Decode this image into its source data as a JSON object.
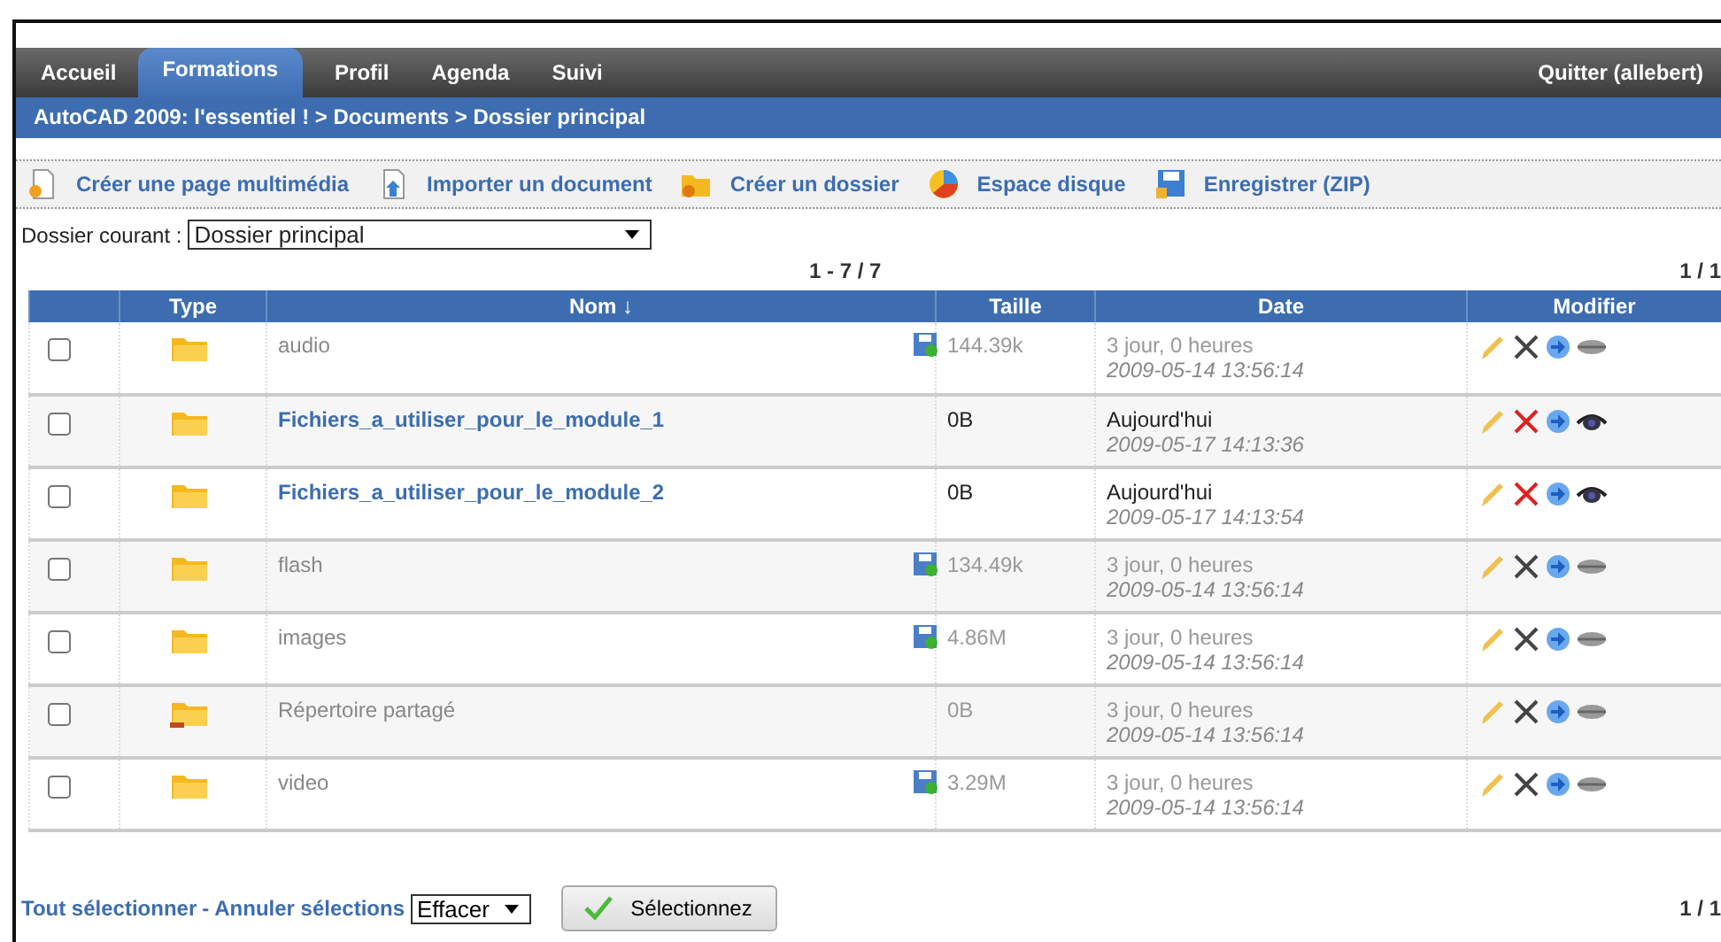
{
  "nav": {
    "tabs": [
      {
        "label": "Accueil",
        "selected": false
      },
      {
        "label": "Formations",
        "selected": true
      },
      {
        "label": "Profil",
        "selected": false
      },
      {
        "label": "Agenda",
        "selected": false
      },
      {
        "label": "Suivi",
        "selected": false
      }
    ],
    "logout": "Quitter (allebert)"
  },
  "breadcrumb": "AutoCAD 2009: l'essentiel ! > Documents > Dossier principal",
  "toolbar": [
    {
      "kind": "new-page",
      "label": "Créer une page multimédia"
    },
    {
      "kind": "upload",
      "label": "Importer un document"
    },
    {
      "kind": "new-folder",
      "label": "Créer un dossier"
    },
    {
      "kind": "disk",
      "label": "Espace disque"
    },
    {
      "kind": "save",
      "label": "Enregistrer (ZIP)"
    }
  ],
  "current_folder": {
    "label": "Dossier courant :",
    "value": "Dossier principal"
  },
  "pagination": {
    "range": "1 - 7 / 7",
    "pages": "1 / 1"
  },
  "table": {
    "columns": [
      "Type",
      "Nom ↓",
      "Taille",
      "Date",
      "Modifier"
    ],
    "rows": [
      {
        "checked": false,
        "kind": "folder",
        "name": "audio",
        "visible": false,
        "zip": true,
        "size": "144.39k",
        "age": "3 jour, 0 heures",
        "date": "2009-05-14 13:56:14"
      },
      {
        "checked": false,
        "kind": "folder",
        "name": "Fichiers_a_utiliser_pour_le_module_1",
        "visible": true,
        "zip": false,
        "size": "0B",
        "age": "Aujourd'hui",
        "date": "2009-05-17 14:13:36"
      },
      {
        "checked": false,
        "kind": "folder",
        "name": "Fichiers_a_utiliser_pour_le_module_2",
        "visible": true,
        "zip": false,
        "size": "0B",
        "age": "Aujourd'hui",
        "date": "2009-05-17 14:13:54"
      },
      {
        "checked": false,
        "kind": "folder",
        "name": "flash",
        "visible": false,
        "zip": true,
        "size": "134.49k",
        "age": "3 jour, 0 heures",
        "date": "2009-05-14 13:56:14"
      },
      {
        "checked": false,
        "kind": "folder",
        "name": "images",
        "visible": false,
        "zip": true,
        "size": "4.86M",
        "age": "3 jour, 0 heures",
        "date": "2009-05-14 13:56:14"
      },
      {
        "checked": false,
        "kind": "shared",
        "name": "Répertoire partagé",
        "visible": false,
        "zip": false,
        "size": "0B",
        "age": "3 jour, 0 heures",
        "date": "2009-05-14 13:56:14"
      },
      {
        "checked": false,
        "kind": "folder",
        "name": "video",
        "visible": false,
        "zip": true,
        "size": "3.29M",
        "age": "3 jour, 0 heures",
        "date": "2009-05-14 13:56:14"
      }
    ]
  },
  "footer": {
    "select_all": "Tout sélectionner",
    "separator": "-",
    "clear": "Annuler sélections",
    "action": "Effacer",
    "button": "Sélectionnez",
    "pages": "1 / 1"
  }
}
